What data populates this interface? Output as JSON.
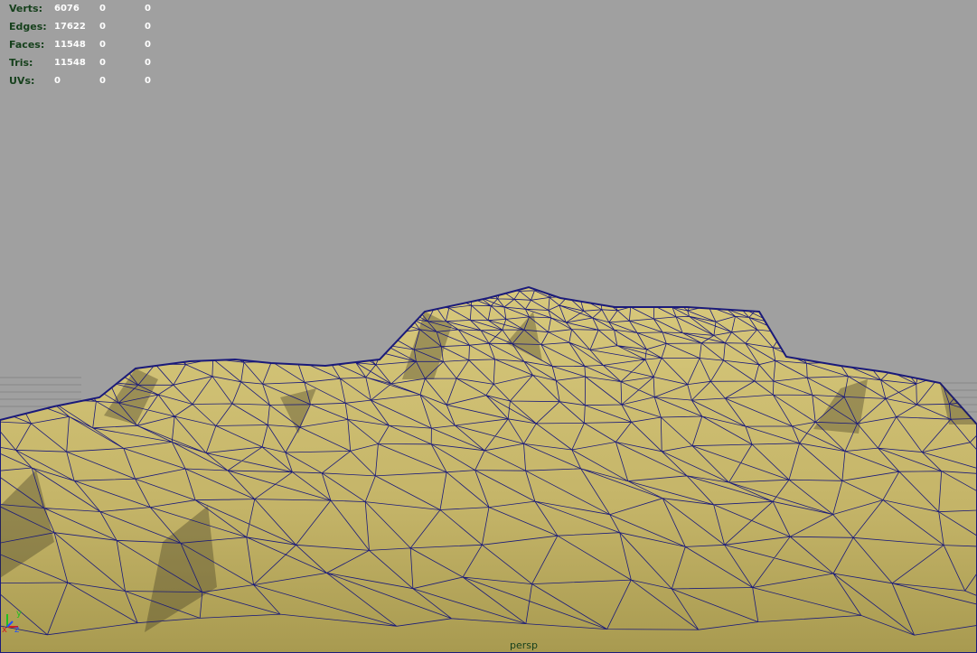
{
  "hud": {
    "verts": {
      "label": "Verts:",
      "v1": "6076",
      "v2": "0",
      "v3": "0"
    },
    "edges": {
      "label": "Edges:",
      "v1": "17622",
      "v2": "0",
      "v3": "0"
    },
    "faces": {
      "label": "Faces:",
      "v1": "11548",
      "v2": "0",
      "v3": "0"
    },
    "tris": {
      "label": "Tris:",
      "v1": "11548",
      "v2": "0",
      "v3": "0"
    },
    "uvs": {
      "label": "UVs:",
      "v1": "0",
      "v2": "0",
      "v3": "0"
    }
  },
  "camera_label": "persp",
  "axis": {
    "x": "x",
    "y": "y",
    "z": "z"
  },
  "colors": {
    "background": "#a0a0a0",
    "mesh_fill": "#c9bb6b",
    "wireframe": "#1a1a7a",
    "hud_label": "#16401c",
    "hud_value": "#ffffff"
  }
}
